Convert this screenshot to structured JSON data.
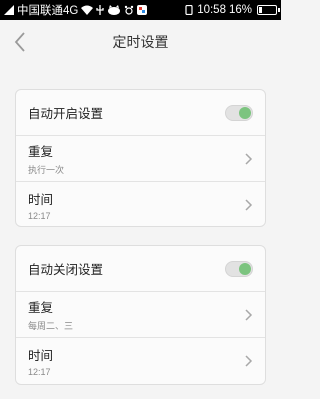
{
  "status_bar": {
    "carrier": "中国联通4G",
    "time": "10:58",
    "battery_percent": "16%",
    "battery_level": 0.16
  },
  "header": {
    "title": "定时设置",
    "back_icon": "chevron-left-icon"
  },
  "auto_on": {
    "label": "自动开启设置",
    "enabled": true,
    "repeat_label": "重复",
    "repeat_value": "执行一次",
    "time_label": "时间",
    "time_value": "12:17"
  },
  "auto_off": {
    "label": "自动关闭设置",
    "enabled": true,
    "repeat_label": "重复",
    "repeat_value": "每周二、三",
    "time_label": "时间",
    "time_value": "12:17"
  },
  "colors": {
    "toggle_on": "#7cc47f",
    "background": "#f4f4f4",
    "status_bar": "#000000"
  }
}
